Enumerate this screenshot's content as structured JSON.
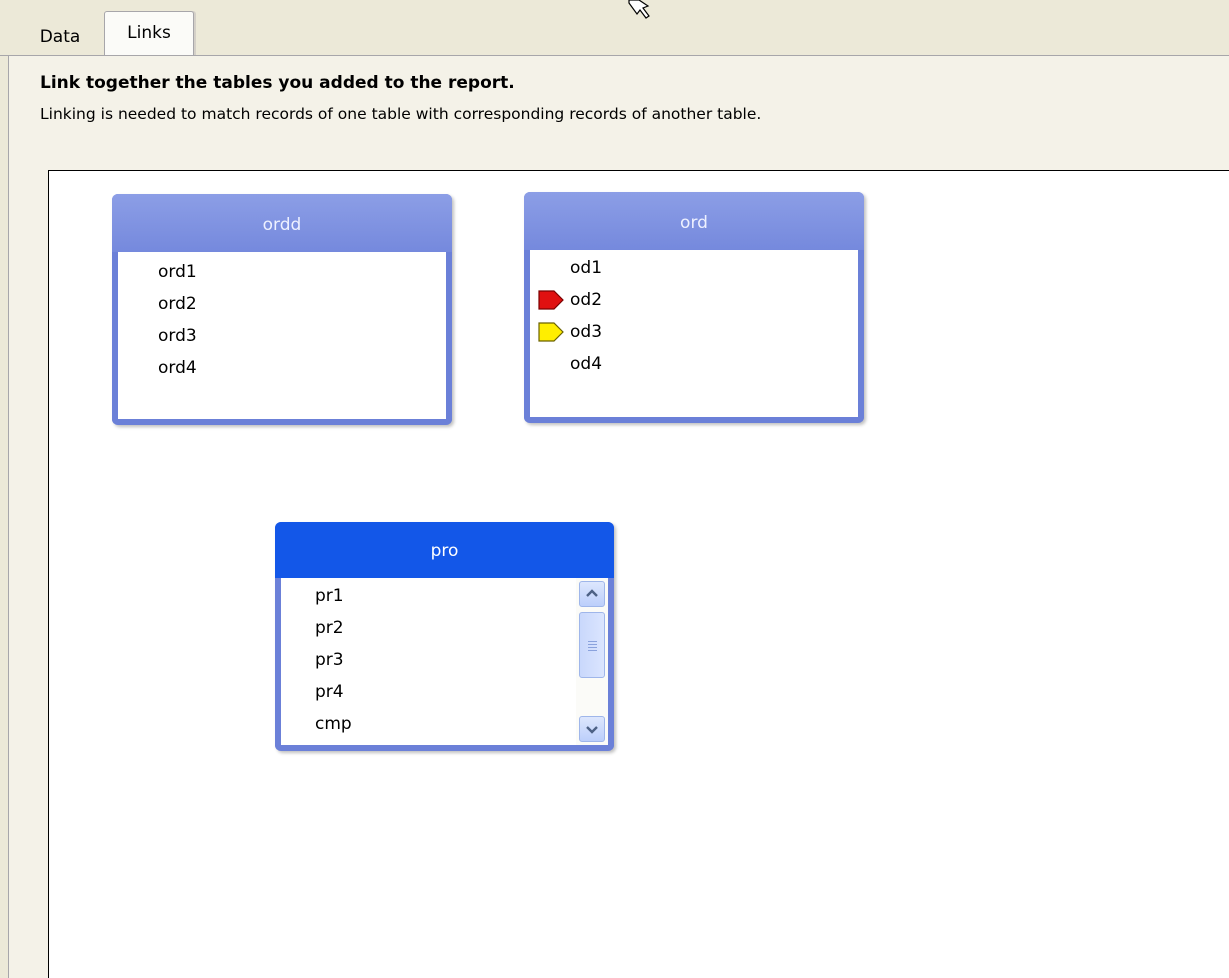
{
  "tabs": {
    "data": "Data",
    "links": "Links"
  },
  "header": {
    "title": "Link together the tables you added to the report.",
    "subtitle": "Linking is needed to match records of one table with corresponding records of another table."
  },
  "tables": {
    "ordd": {
      "name": "ordd",
      "fields": [
        "ord1",
        "ord2",
        "ord3",
        "ord4"
      ]
    },
    "ord": {
      "name": "ord",
      "fields": [
        "od1",
        "od2",
        "od3",
        "od4"
      ]
    },
    "pro": {
      "name": "pro",
      "fields": [
        "pr1",
        "pr2",
        "pr3",
        "pr4",
        "cmp"
      ]
    }
  },
  "colors": {
    "table_border": "#6b80d8",
    "active_header": "#1357e8",
    "key_red": "#e01010",
    "key_yellow": "#ffee00"
  }
}
